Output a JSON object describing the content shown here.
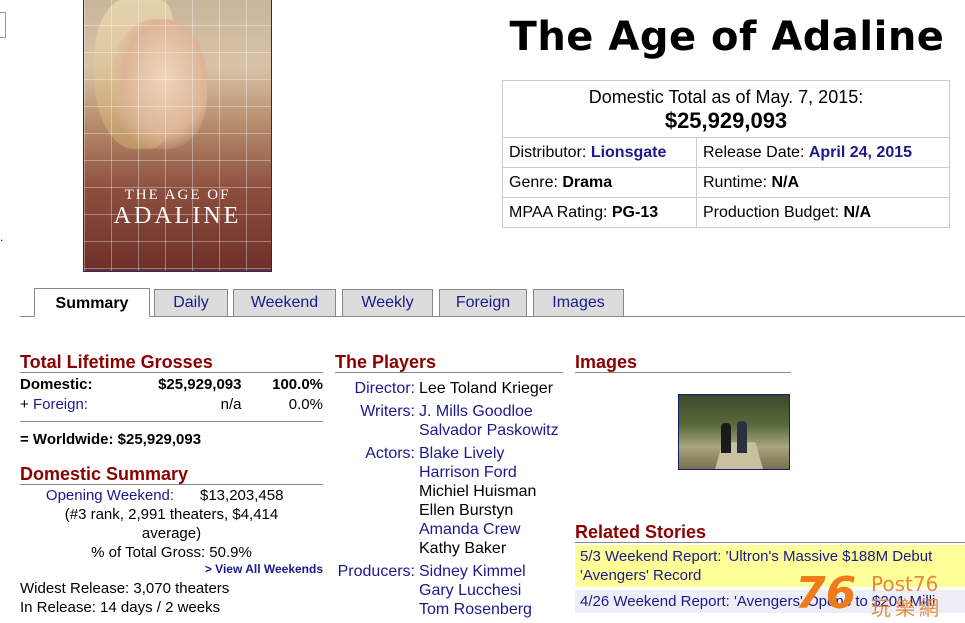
{
  "movie": {
    "title": "The Age of Adaline"
  },
  "poster": {
    "line1": "THE AGE OF",
    "line2": "ADALINE"
  },
  "info": {
    "domestic_total_label": "Domestic Total as of May. 7, 2015:",
    "domestic_total_value": "$25,929,093",
    "distributor_label": "Distributor:",
    "distributor_value": "Lionsgate",
    "release_label": "Release Date:",
    "release_value": "April 24, 2015",
    "genre_label": "Genre:",
    "genre_value": "Drama",
    "runtime_label": "Runtime:",
    "runtime_value": "N/A",
    "mpaa_label": "MPAA Rating:",
    "mpaa_value": "PG-13",
    "budget_label": "Production Budget:",
    "budget_value": "N/A"
  },
  "tabs": [
    "Summary",
    "Daily",
    "Weekend",
    "Weekly",
    "Foreign",
    "Images"
  ],
  "grosses": {
    "heading": "Total Lifetime Grosses",
    "domestic_label": "Domestic:",
    "domestic_value": "$25,929,093",
    "domestic_pct": "100.0%",
    "foreign_prefix": "+",
    "foreign_label": "Foreign:",
    "foreign_value": "n/a",
    "foreign_pct": "0.0%",
    "worldwide_label": "= Worldwide:",
    "worldwide_value": "$25,929,093"
  },
  "domestic_summary": {
    "heading": "Domestic Summary",
    "opening_label": "Opening Weekend:",
    "opening_value": "$13,203,458",
    "opening_detail": "(#3 rank, 2,991 theaters, $4,414 average)",
    "pct_total": "% of Total Gross: 50.9%",
    "view_all": "> View All Weekends",
    "widest_release": "Widest Release: 3,070 theaters",
    "in_release": "In Release: 14 days / 2 weeks"
  },
  "players": {
    "heading": "The Players",
    "director_label": "Director:",
    "director": "Lee Toland Krieger",
    "writers_label": "Writers:",
    "writers": [
      "J. Mills Goodloe",
      "Salvador Paskowitz"
    ],
    "actors_label": "Actors:",
    "actors": [
      "Blake Lively",
      "Harrison Ford",
      "Michiel Huisman",
      "Ellen Burstyn",
      "Amanda Crew",
      "Kathy Baker"
    ],
    "producers_label": "Producers:",
    "producers": [
      "Sidney Kimmel",
      "Gary Lucchesi",
      "Tom Rosenberg"
    ]
  },
  "images": {
    "heading": "Images"
  },
  "related": {
    "heading": "Related Stories",
    "stories": [
      "5/3 Weekend Report: 'Ultron's Massive $188M Debut 'Avengers' Record",
      "4/26 Weekend Report: 'Avengers' Opens to $201 Milli"
    ]
  },
  "watermark": {
    "number": "76",
    "post": "Post76",
    "cn": "玩樂網"
  }
}
